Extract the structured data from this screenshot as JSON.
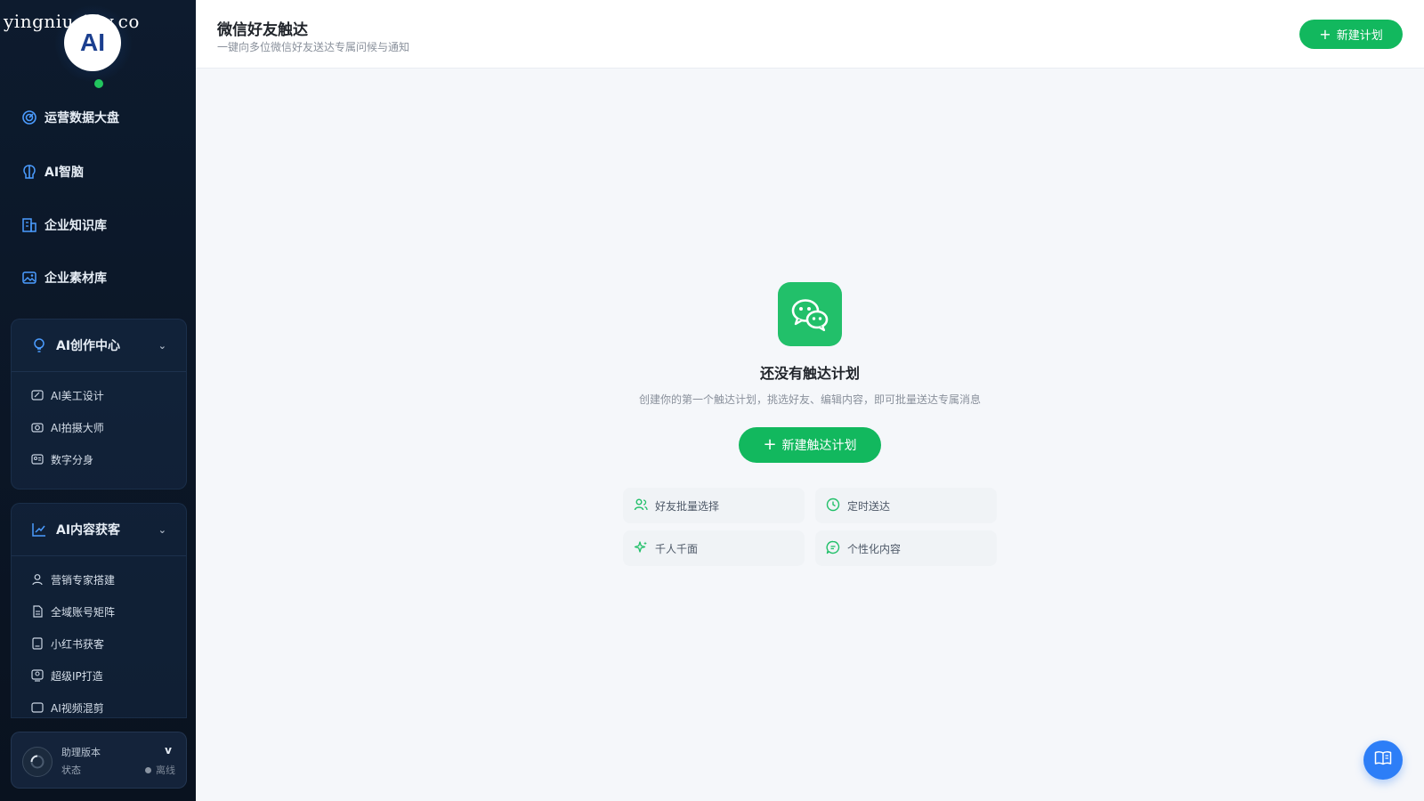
{
  "watermark": "yingniu.10v.co",
  "sidebar": {
    "avatar_text": "AI",
    "nav": [
      {
        "label": "运营数据大盘",
        "icon": "dashboard-icon"
      },
      {
        "label": "AI智脑",
        "icon": "brain-icon"
      },
      {
        "label": "企业知识库",
        "icon": "building-icon"
      },
      {
        "label": "企业素材库",
        "icon": "image-icon"
      }
    ],
    "groups": [
      {
        "title": "AI创作中心",
        "icon": "bulb-icon",
        "items": [
          {
            "label": "AI美工设计",
            "icon": "design-icon"
          },
          {
            "label": "AI拍摄大师",
            "icon": "camera-icon"
          },
          {
            "label": "数字分身",
            "icon": "avatar-card-icon"
          }
        ]
      },
      {
        "title": "AI内容获客",
        "icon": "trend-icon",
        "items": [
          {
            "label": "营销专家搭建",
            "icon": "user-icon"
          },
          {
            "label": "全域账号矩阵",
            "icon": "document-icon"
          },
          {
            "label": "小红书获客",
            "icon": "ai-doc-icon"
          },
          {
            "label": "超级IP打造",
            "icon": "badge-icon"
          },
          {
            "label": "AI视频混剪",
            "icon": "video-icon"
          }
        ]
      }
    ],
    "assistant": {
      "label": "助理版本",
      "version": "v",
      "status_label": "状态",
      "status_value": "离线"
    }
  },
  "header": {
    "title": "微信好友触达",
    "subtitle": "一键向多位微信好友送达专属问候与通知",
    "new_plan_button": "新建计划"
  },
  "empty_state": {
    "icon": "wechat-icon",
    "title": "还没有触达计划",
    "description": "创建你的第一个触达计划，挑选好友、编辑内容，即可批量送达专属消息",
    "button": "新建触达计划"
  },
  "features": [
    {
      "label": "好友批量选择",
      "icon": "users-icon"
    },
    {
      "label": "定时送达",
      "icon": "clock-icon"
    },
    {
      "label": "千人千面",
      "icon": "sparkle-icon"
    },
    {
      "label": "个性化内容",
      "icon": "chat-icon"
    }
  ],
  "colors": {
    "brand_green": "#12b85e",
    "sidebar_bg": "#0d1b2e",
    "fab_blue": "#2d7ef7",
    "online": "#22c55e"
  }
}
